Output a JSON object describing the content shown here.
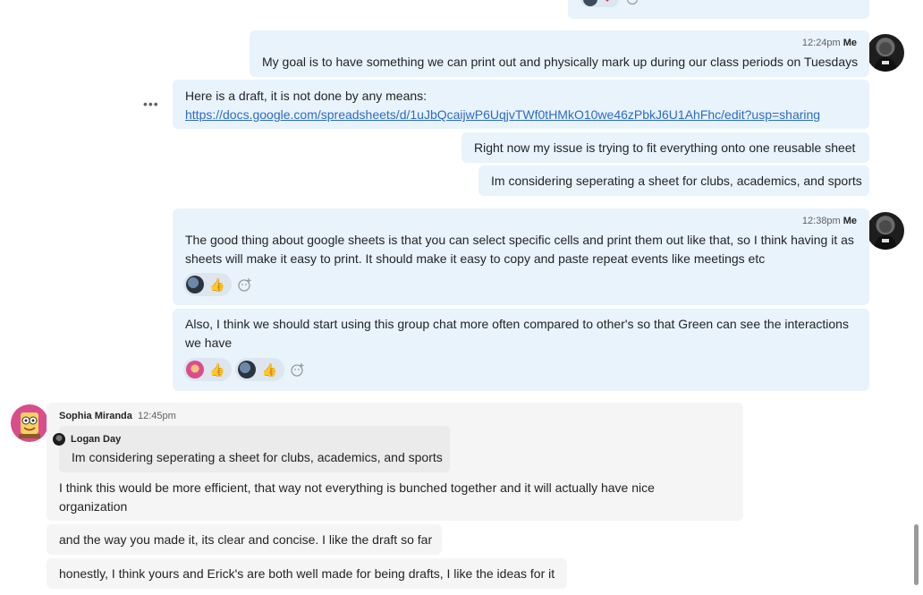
{
  "messages_me": {
    "m1": {
      "time": "12:24pm",
      "author": "Me",
      "text": "My goal is to have something we can print out and physically mark up during our class periods on Tuesdays"
    },
    "m2": {
      "text": "Here is a draft, it is not done by any means:",
      "link": "https://docs.google.com/spreadsheets/d/1uJbQcaijwP6UqjvTWf0tHMkO10we46zPbkJ6U1AhFhc/edit?usp=sharing"
    },
    "m3": {
      "text": "Right now my issue is trying to fit everything onto one reusable sheet"
    },
    "m4": {
      "text": "Im considering seperating a sheet for clubs, academics, and sports"
    },
    "m5": {
      "time": "12:38pm",
      "author": "Me",
      "text": "The good thing about google sheets is that you can select specific cells and print them out like that, so I think having it as sheets will make it easy to print. It should make it easy to copy and paste repeat events like meetings etc"
    },
    "m6": {
      "text": "Also, I think we should start using this group chat more often compared to other's so that Green can see the interactions we have"
    }
  },
  "messages_other": {
    "author": "Sophia Miranda",
    "time": "12:45pm",
    "quote_author": "Logan Day",
    "quote_text": "Im considering seperating a sheet for clubs, academics, and sports",
    "m1": "I think this would be more efficient, that way not everything is bunched together and it will actually have nice organization",
    "m2": "and the way you made it, its clear and concise. I like the draft so far",
    "m3": "honestly, I think yours and Erick's are both well made for being drafts, I like the ideas for it"
  },
  "more_options": "•••",
  "icons": {
    "thumbs_up": "👍",
    "heart": "❤",
    "add_reaction": "add-reaction-icon"
  },
  "colors": {
    "me_bubble": "#e8f3fc",
    "other_bubble": "#f5f5f5",
    "link": "#2b6cc6"
  }
}
